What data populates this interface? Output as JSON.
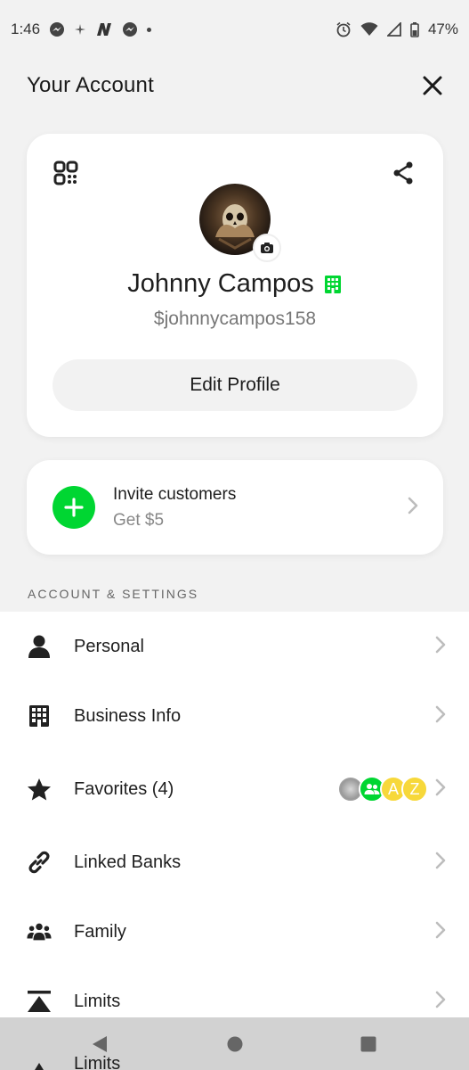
{
  "status_bar": {
    "time": "1:46",
    "battery": "47%",
    "left_icons": [
      "messenger-icon",
      "pinwheel-icon",
      "n-app-icon",
      "messenger-icon",
      "dot-icon"
    ],
    "right_icons": [
      "alarm-icon",
      "wifi-icon",
      "signal-icon",
      "battery-icon"
    ]
  },
  "header": {
    "title": "Your Account",
    "close_icon": "close-icon"
  },
  "profile": {
    "name": "Johnny Campos",
    "cashtag": "$johnnycampos158",
    "edit_label": "Edit Profile",
    "business_badge_color": "#00d632"
  },
  "invite": {
    "title": "Invite customers",
    "subtitle": "Get $5"
  },
  "section": {
    "label": "ACCOUNT & SETTINGS"
  },
  "settings": {
    "items": [
      {
        "label": "Personal",
        "icon": "person-icon"
      },
      {
        "label": "Business Info",
        "icon": "building-icon"
      },
      {
        "label": "Favorites (4)",
        "icon": "star-icon"
      },
      {
        "label": "Linked Banks",
        "icon": "link-icon"
      },
      {
        "label": "Family",
        "icon": "family-icon"
      },
      {
        "label": "Limits",
        "icon": "limits-icon"
      }
    ],
    "favorites_avatars": [
      "",
      "",
      "A",
      "Z"
    ],
    "peek_label": "Limits"
  },
  "colors": {
    "accent": "#00d632",
    "favorite_yellow": "#f7d83a",
    "background": "#f2f2f2"
  }
}
